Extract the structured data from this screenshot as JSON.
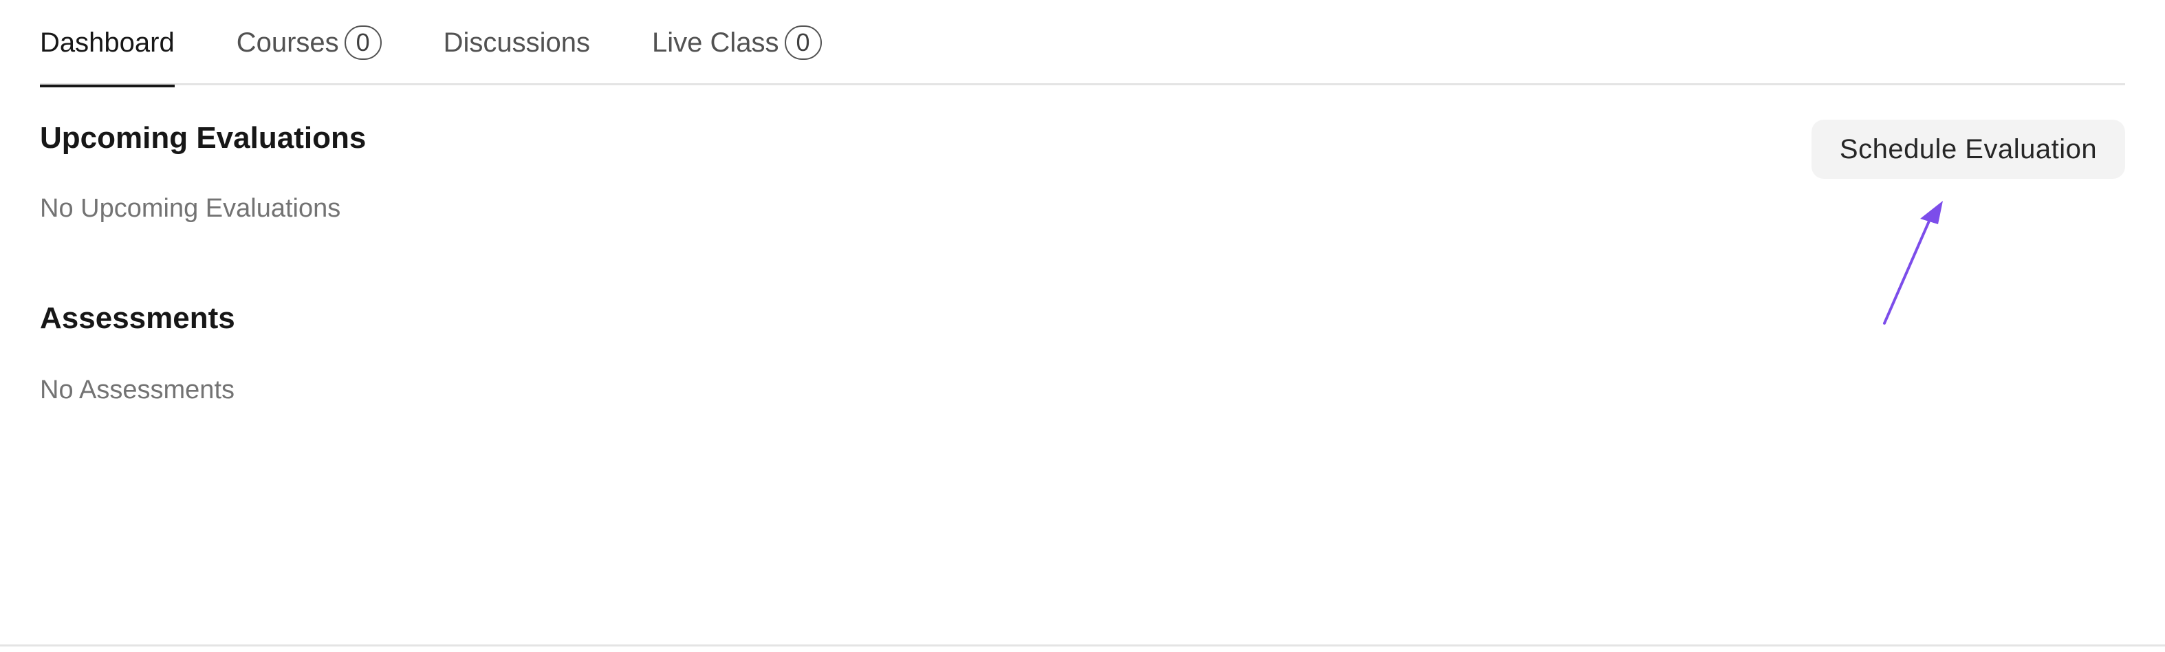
{
  "tabs": [
    {
      "label": "Dashboard",
      "active": true
    },
    {
      "label": "Courses",
      "count": "0"
    },
    {
      "label": "Discussions"
    },
    {
      "label": "Live Class",
      "count": "0"
    }
  ],
  "upcoming": {
    "title": "Upcoming Evaluations",
    "empty_text": "No Upcoming Evaluations",
    "button_label": "Schedule Evaluation"
  },
  "assessments": {
    "title": "Assessments",
    "empty_text": "No Assessments"
  },
  "annotation": {
    "icon": "arrow-pointer-icon",
    "color": "#7c4dea"
  }
}
